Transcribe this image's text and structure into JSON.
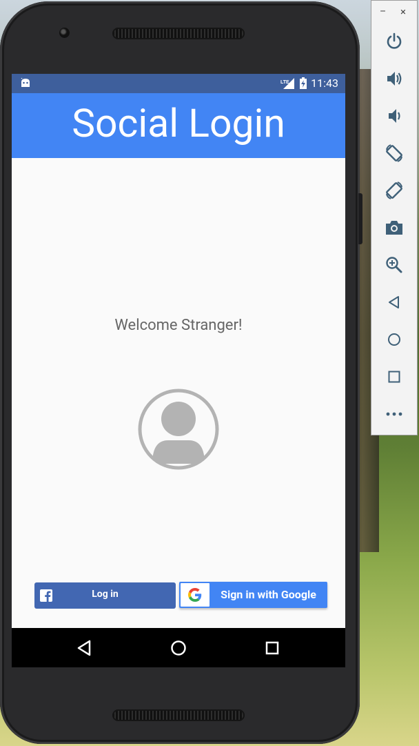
{
  "status_bar": {
    "time": "11:43",
    "network": "LTE"
  },
  "app": {
    "title": "Social Login",
    "welcome": "Welcome Stranger!",
    "facebook_button": "Log in",
    "google_button": "Sign in with Google"
  },
  "toolbar": {
    "minimize": "–",
    "close": "×"
  },
  "colors": {
    "status_bar": "#3e5f9c",
    "app_bar": "#4285f4",
    "facebook": "#4267b2",
    "google": "#4285f4",
    "screen_bg": "#fafafa"
  }
}
